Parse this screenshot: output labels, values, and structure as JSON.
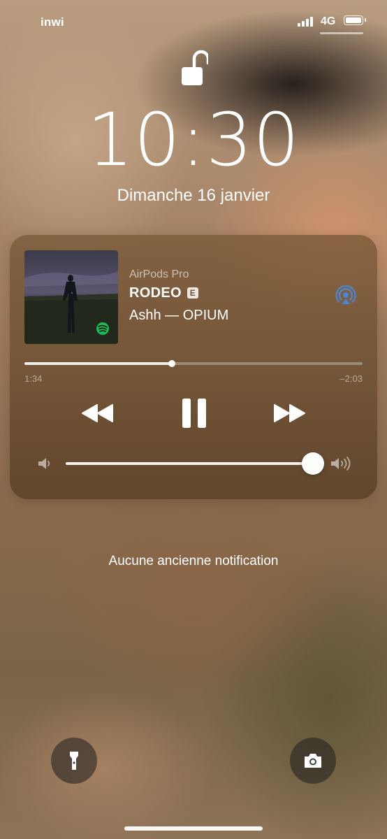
{
  "status_bar": {
    "carrier": "inwi",
    "network": "4G",
    "signal_icon": "cellular-signal-icon",
    "battery_icon": "battery-icon",
    "battery_level": 1.0
  },
  "lock_screen": {
    "lock_icon": "unlocked-padlock-icon",
    "time": "10:30",
    "date": "Dimanche 16 janvier"
  },
  "now_playing": {
    "device": "AirPods Pro",
    "title": "RODEO",
    "explicit_badge": "E",
    "artist_album": "Ashh — OPIUM",
    "source_icon": "spotify-icon",
    "route_icon": "airplay-audio-icon",
    "elapsed": "1:34",
    "remaining": "–2:03",
    "progress_fraction": 0.435,
    "volume_fraction": 0.995,
    "controls": {
      "rewind_icon": "rewind-icon",
      "pause_icon": "pause-icon",
      "forward_icon": "fast-forward-icon"
    },
    "volume_low_icon": "speaker-low-icon",
    "volume_high_icon": "speaker-high-icon"
  },
  "notifications": {
    "empty_text": "Aucune ancienne notification"
  },
  "quick_actions": {
    "flashlight_icon": "flashlight-icon",
    "camera_icon": "camera-icon"
  },
  "colors": {
    "airplay_accent": "#4a86d8",
    "spotify_green": "#1db954"
  }
}
